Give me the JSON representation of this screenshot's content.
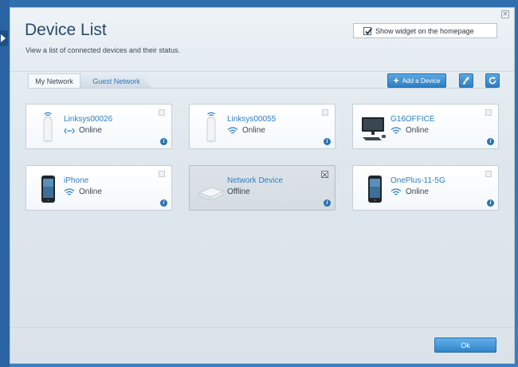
{
  "header": {
    "title": "Device List",
    "subtitle": "View a list of connected devices and their status.",
    "widget_label": "Show widget on the homepage",
    "widget_checked": true
  },
  "tabs": [
    {
      "label": "My Network",
      "active": true
    },
    {
      "label": "Guest Network",
      "active": false
    }
  ],
  "toolbar": {
    "add_label": "Add a Device",
    "brush_icon": "brush-icon",
    "refresh_icon": "refresh-icon"
  },
  "devices": [
    {
      "name": "Linksys00026",
      "status": "Online",
      "connection": "wired",
      "image": "router-node",
      "offline": false
    },
    {
      "name": "Linksys00055",
      "status": "Online",
      "connection": "wifi",
      "image": "router-node",
      "offline": false
    },
    {
      "name": "G16OFFICE",
      "status": "Online",
      "connection": "wifi",
      "image": "desktop-computer",
      "offline": false
    },
    {
      "name": "iPhone",
      "status": "Online",
      "connection": "wifi",
      "image": "smartphone",
      "offline": false
    },
    {
      "name": "Network Device",
      "status": "Offline",
      "connection": "none",
      "image": "network-device",
      "offline": true
    },
    {
      "name": "OnePlus-11-5G",
      "status": "Online",
      "connection": "wifi",
      "image": "smartphone",
      "offline": false
    }
  ],
  "footer": {
    "ok_label": "Ok"
  },
  "colors": {
    "accent": "#2f80c3",
    "background": "#2f6fae"
  }
}
